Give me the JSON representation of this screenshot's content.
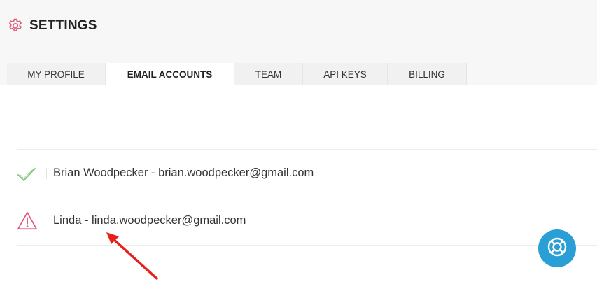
{
  "header": {
    "title": "SETTINGS",
    "icon": "gear-icon",
    "accent_color": "#e0577a"
  },
  "tabs": [
    {
      "label": "MY PROFILE",
      "active": false
    },
    {
      "label": "EMAIL ACCOUNTS",
      "active": true
    },
    {
      "label": "TEAM",
      "active": false
    },
    {
      "label": "API KEYS",
      "active": false
    },
    {
      "label": "BILLING",
      "active": false
    }
  ],
  "accounts": [
    {
      "text": "Brian Woodpecker - brian.woodpecker@gmail.com",
      "status": "verified",
      "status_icon": "checkmark-icon",
      "status_color": "#7cc576"
    },
    {
      "text": "Linda - linda.woodpecker@gmail.com",
      "status": "warning",
      "status_icon": "warning-triangle-icon",
      "status_color": "#e0577a"
    }
  ],
  "annotation": {
    "icon": "arrow-icon",
    "color": "#e8201c"
  },
  "help_button": {
    "icon": "lifebuoy-icon",
    "color": "#2a9fd6"
  }
}
